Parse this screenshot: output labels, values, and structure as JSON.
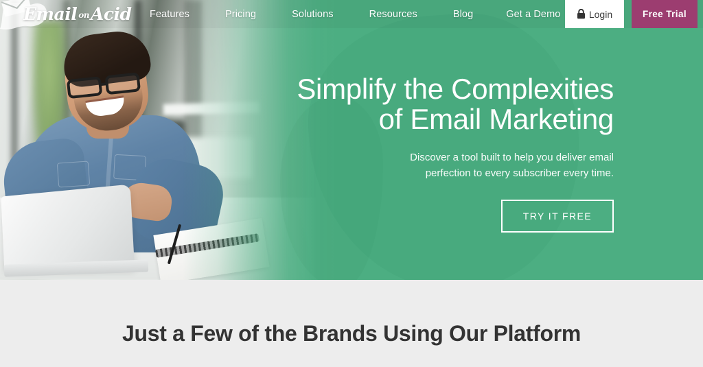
{
  "brand": {
    "logo_text_part1": "Email",
    "logo_text_small": "on",
    "logo_text_part2": "Acid"
  },
  "nav": {
    "links": [
      {
        "label": "Features"
      },
      {
        "label": "Pricing"
      },
      {
        "label": "Solutions"
      },
      {
        "label": "Resources"
      },
      {
        "label": "Blog"
      },
      {
        "label": "Get a Demo"
      }
    ],
    "login_label": "Login",
    "login_icon": "lock-icon",
    "trial_label": "Free Trial"
  },
  "hero": {
    "title": "Simplify the Complexities\nof Email Marketing",
    "subtitle": "Discover a tool built to help you deliver email\nperfection to every subscriber every time.",
    "cta_label": "TRY IT FREE"
  },
  "brands_section": {
    "title": "Just a Few of the Brands Using Our Platform"
  },
  "colors": {
    "green": "#4cae82",
    "magenta": "#9c3d70",
    "light_grey": "#ededed",
    "dark_text": "#333333",
    "white": "#ffffff"
  }
}
